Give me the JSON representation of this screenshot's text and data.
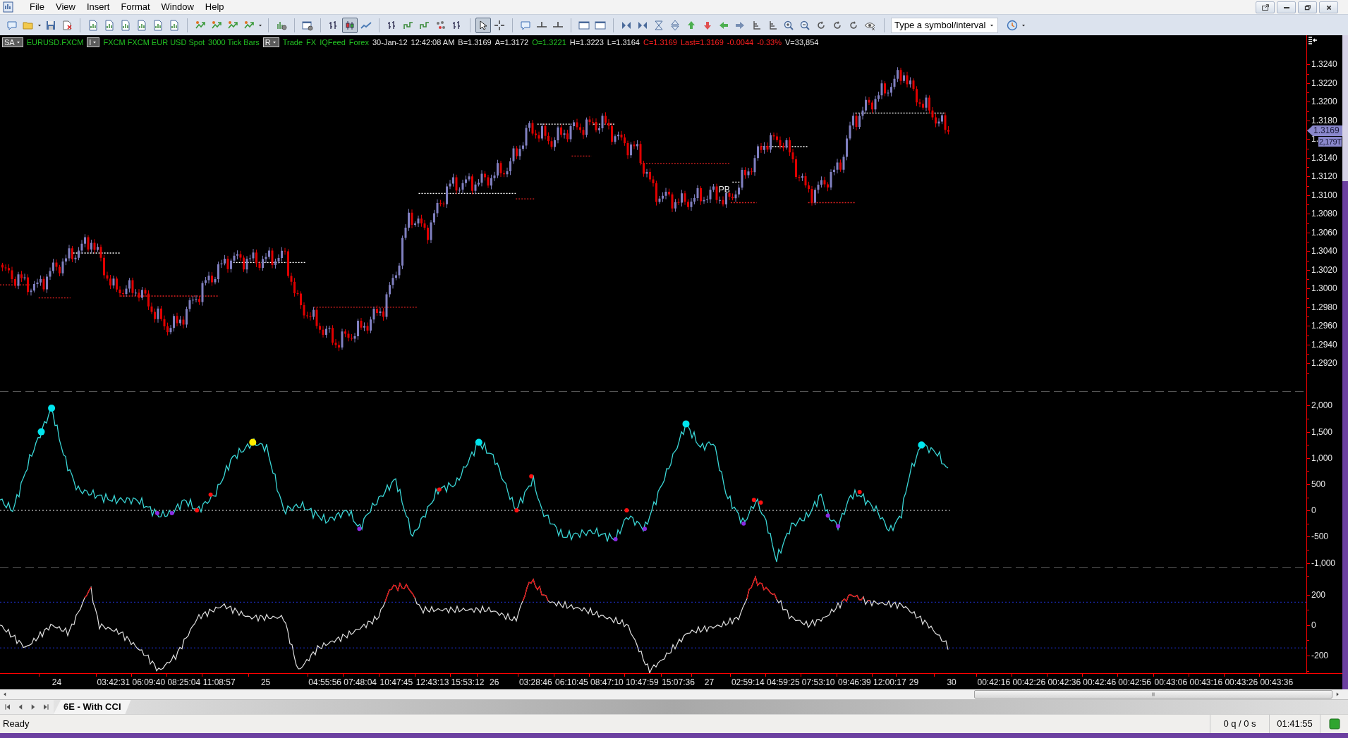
{
  "menu": [
    {
      "label": "File"
    },
    {
      "label": "View"
    },
    {
      "label": "Insert"
    },
    {
      "label": "Format"
    },
    {
      "label": "Window"
    },
    {
      "label": "Help"
    }
  ],
  "toolbar": {
    "groups": [
      [
        {
          "selected": false
        },
        {
          "selected": false
        },
        {
          "selected": false
        },
        {
          "selected": false
        }
      ],
      [
        {
          "selected": false
        },
        {
          "selected": false
        },
        {
          "selected": false
        },
        {
          "selected": false
        },
        {
          "selected": false
        },
        {
          "selected": false
        }
      ],
      [
        {
          "selected": false
        },
        {
          "selected": false
        },
        {
          "selected": false
        },
        {
          "selected": false
        }
      ],
      [
        {
          "selected": false
        }
      ],
      [
        {
          "selected": false
        }
      ],
      [
        {
          "selected": false
        },
        {
          "selected": true
        },
        {
          "selected": false
        }
      ],
      [
        {
          "selected": false
        },
        {
          "selected": false
        },
        {
          "selected": false
        },
        {
          "selected": false
        },
        {
          "selected": false
        }
      ],
      [
        {
          "selected": true
        },
        {
          "selected": false
        }
      ],
      [
        {
          "selected": false
        },
        {
          "selected": false
        },
        {
          "selected": false
        }
      ],
      [
        {
          "selected": false
        },
        {
          "selected": false
        }
      ],
      [
        {
          "selected": false
        },
        {
          "selected": false
        },
        {
          "selected": false
        },
        {
          "selected": false
        },
        {
          "selected": false
        },
        {
          "selected": false
        },
        {
          "selected": false
        },
        {
          "selected": false
        },
        {
          "selected": false
        },
        {
          "selected": false
        },
        {
          "selected": false
        },
        {
          "selected": false
        },
        {
          "selected": false
        },
        {
          "selected": false
        },
        {
          "selected": false
        },
        {
          "selected": false
        }
      ]
    ],
    "symbol_field": {
      "placeholder": "Type a symbol/interval"
    }
  },
  "chart": {
    "header": [
      {
        "kind": "box",
        "text": "SA"
      },
      {
        "kind": "text",
        "text": "EURUSD.FXCM",
        "color": "#22c022"
      },
      {
        "kind": "box",
        "text": "I"
      },
      {
        "kind": "text",
        "text": "FXCM FXCM EUR USD Spot",
        "color": "#22c022"
      },
      {
        "kind": "text",
        "text": "3000 Tick Bars",
        "color": "#22c022"
      },
      {
        "kind": "box",
        "text": "R"
      },
      {
        "kind": "text",
        "text": "Trade",
        "color": "#22c022"
      },
      {
        "kind": "text",
        "text": "FX",
        "color": "#22c022"
      },
      {
        "kind": "text",
        "text": "IQFeed",
        "color": "#22c022"
      },
      {
        "kind": "text",
        "text": "Forex",
        "color": "#22c022"
      },
      {
        "kind": "text",
        "text": "30-Jan-12",
        "color": "#e8e8e8"
      },
      {
        "kind": "text",
        "text": "12:42:08 AM",
        "color": "#e8e8e8"
      },
      {
        "kind": "text",
        "text": "B=1.3169",
        "color": "#e8e8e8"
      },
      {
        "kind": "text",
        "text": "A=1.3172",
        "color": "#e8e8e8"
      },
      {
        "kind": "text",
        "text": "O=1.3221",
        "color": "#22c022"
      },
      {
        "kind": "text",
        "text": "H=1.3223",
        "color": "#e8e8e8"
      },
      {
        "kind": "text",
        "text": "L=1.3164",
        "color": "#e8e8e8"
      },
      {
        "kind": "text",
        "text": "C=1.3169",
        "color": "#ff2020"
      },
      {
        "kind": "text",
        "text": "Last=1.3169",
        "color": "#ff2020"
      },
      {
        "kind": "text",
        "text": "-0.0044",
        "color": "#ff2020"
      },
      {
        "kind": "text",
        "text": "-0.33%",
        "color": "#ff2020"
      },
      {
        "kind": "text",
        "text": "V=33,854",
        "color": "#e8e8e8"
      }
    ],
    "annotation": "PB",
    "price_axis": [
      "1.3240",
      "1.3220",
      "1.3200",
      "1.3180",
      "1.",
      "1.3140",
      "1.3120",
      "1.3100",
      "1.3080",
      "1.3060",
      "1.3040",
      "1.3020",
      "1.3000",
      "1.2980",
      "1.2960",
      "1.2940",
      "1.2920"
    ],
    "last_price_tag": "1.3169",
    "tick_count_tag": "2,179T",
    "cci_axis": [
      "2,000",
      "1,500",
      "1,000",
      "500",
      "0",
      "-500",
      "-1,000"
    ],
    "oscillator_axis": [
      "200",
      "0",
      "-200"
    ],
    "time_axis": [
      "24",
      "03:42:31",
      "06:09:40",
      "08:25:04",
      "11:08:57",
      "25",
      "04:55:56",
      "07:48:04",
      "10:47:45",
      "12:43:13",
      "15:53:12",
      "26",
      "03:28:46",
      "06:10:45",
      "08:47:10",
      "10:47:59",
      "15:07:36",
      "27",
      "02:59:14",
      "04:59:25",
      "07:53:10",
      "09:46:39",
      "12:00:17",
      "29",
      "30",
      "00:42:16",
      "00:42:26",
      "00:42:36",
      "00:42:46",
      "00:42:56",
      "00:43:06",
      "00:43:16",
      "00:43:26",
      "00:43:36"
    ]
  },
  "tabs": [
    {
      "label": "6E - With CCI",
      "selected": true
    }
  ],
  "status_bar": {
    "message": "Ready",
    "queue": "0 q / 0 s",
    "clock": "01:41:55"
  }
}
